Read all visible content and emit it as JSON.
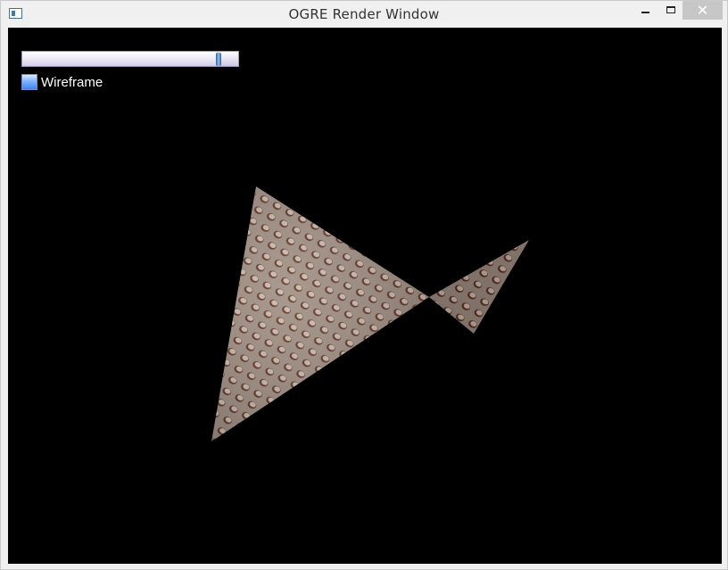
{
  "window": {
    "title": "OGRE Render Window",
    "controls": {
      "minimize_icon": "minimize-icon",
      "maximize_icon": "maximize-icon",
      "close_label": "✕"
    }
  },
  "overlay": {
    "slider": {
      "value_fraction": 0.91
    },
    "checkbox": {
      "label": "Wireframe",
      "checked": false
    }
  },
  "scene": {
    "object": "textured-twisted-surface-mesh",
    "colors": {
      "background": "#000000",
      "texture_base": "#9c8a7c",
      "texture_spot": "#6b3a2a"
    }
  }
}
